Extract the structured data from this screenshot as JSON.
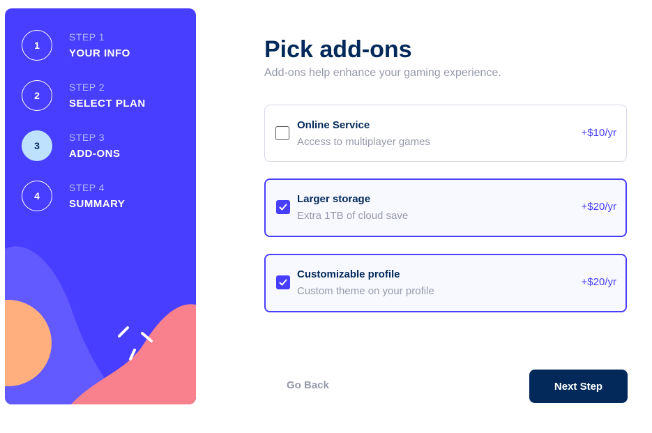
{
  "colors": {
    "sidebar_bg": "#483EFF",
    "active_step_bg": "#BEE2FD",
    "primary_text": "#022959",
    "muted_text": "#9699AA",
    "accent": "#483EFF",
    "next_button_bg": "#022959"
  },
  "sidebar": {
    "steps": [
      {
        "number": "1",
        "label": "STEP 1",
        "title": "YOUR INFO",
        "active": false
      },
      {
        "number": "2",
        "label": "STEP 2",
        "title": "SELECT PLAN",
        "active": false
      },
      {
        "number": "3",
        "label": "STEP 3",
        "title": "ADD-ONS",
        "active": true
      },
      {
        "number": "4",
        "label": "STEP 4",
        "title": "SUMMARY",
        "active": false
      }
    ]
  },
  "main": {
    "title": "Pick add-ons",
    "subtitle": "Add-ons help enhance your gaming experience.",
    "addons": [
      {
        "name": "Online Service",
        "description": "Access to multiplayer games",
        "price": "+$10/yr",
        "checked": false
      },
      {
        "name": "Larger storage",
        "description": "Extra 1TB of cloud save",
        "price": "+$20/yr",
        "checked": true
      },
      {
        "name": "Customizable profile",
        "description": "Custom theme on your profile",
        "price": "+$20/yr",
        "checked": true
      }
    ],
    "go_back_label": "Go Back",
    "next_step_label": "Next Step"
  }
}
